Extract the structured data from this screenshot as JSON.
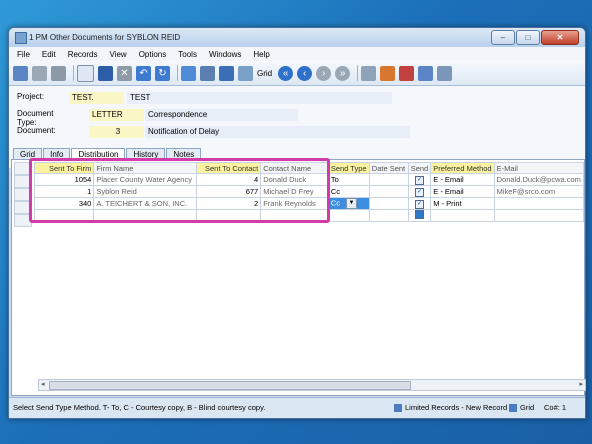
{
  "window": {
    "title": "1 PM Other Documents for SYBLON REID"
  },
  "menu": [
    "File",
    "Edit",
    "Records",
    "View",
    "Options",
    "Tools",
    "Windows",
    "Help"
  ],
  "toolbar": {
    "grid_label": "Grid"
  },
  "fields": {
    "project": {
      "label": "Project:",
      "code": "TEST.",
      "value": "TEST"
    },
    "doctype": {
      "label": "Document Type:",
      "code": "LETTER",
      "value": "Correspondence"
    },
    "document": {
      "label": "Document:",
      "code": "3",
      "value": "Notification of Delay"
    }
  },
  "tabs": [
    "Grid",
    "Info",
    "Distribution",
    "History",
    "Notes"
  ],
  "grid": {
    "headers": {
      "sent_to_firm": "Sent To Firm",
      "firm_name": "Firm Name",
      "sent_to_contact": "Sent To Contact",
      "contact_name": "Contact Name",
      "send_type": "Send Type",
      "date_sent": "Date Sent",
      "send": "Send",
      "preferred_method": "Preferred Method",
      "email": "E-Mail"
    },
    "rows": [
      {
        "firm": "1054",
        "firm_name": "Placer County Water Agency",
        "contact": "4",
        "contact_name": "Donald   Duck",
        "send_type": "To",
        "date_sent": "",
        "method": "E - Email",
        "email": "Donald.Duck@pcwa.com"
      },
      {
        "firm": "1",
        "firm_name": "Syblon Reid",
        "contact": "677",
        "contact_name": "Michael D Frey",
        "send_type": "Cc",
        "date_sent": "",
        "method": "E - Email",
        "email": "MikeF@srco.com"
      },
      {
        "firm": "340",
        "firm_name": "A. TEICHERT & SON, INC.",
        "contact": "2",
        "contact_name": "Frank   Reynolds",
        "send_type": "Cc",
        "date_sent": "",
        "method": "M - Print",
        "email": ""
      }
    ]
  },
  "status": {
    "message": "Select Send Type Method. T- To, C - Courtesy copy, B - Blind courtesy copy.",
    "limited": "Limited Records - New Record",
    "grid": "Grid",
    "co": "Co#: 1"
  }
}
